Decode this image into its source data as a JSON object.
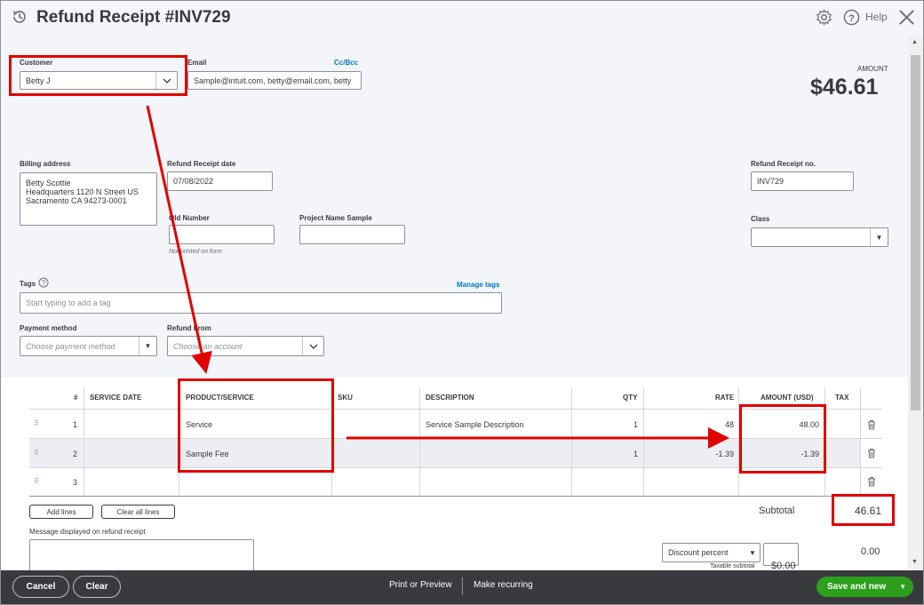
{
  "header": {
    "title": "Refund Receipt #INV729",
    "help_label": "Help",
    "icons": [
      "history-icon",
      "gear-icon",
      "help-icon",
      "close-icon"
    ]
  },
  "customer": {
    "label": "Customer",
    "value": "Betty J"
  },
  "email": {
    "label": "Email",
    "value": "Sample@intuit.com, betty@email.com, betty",
    "cc_bcc": "Cc/Bcc"
  },
  "amount": {
    "label": "AMOUNT",
    "value": "$46.61"
  },
  "billing": {
    "label": "Billing address",
    "value": "Betty Scottie\nHeadquarters 1120 N Street US\nSacramento CA 94273-0001"
  },
  "refund_date": {
    "label": "Refund Receipt date",
    "value": "07/08/2022"
  },
  "refund_no": {
    "label": "Refund Receipt no.",
    "value": "INV729"
  },
  "old_number": {
    "label": "Old Number",
    "hint": "Not printed on form"
  },
  "project_name": {
    "label": "Project Name Sample"
  },
  "class_field": {
    "label": "Class"
  },
  "tags": {
    "label": "Tags",
    "manage": "Manage tags",
    "placeholder": "Start typing to add a tag"
  },
  "payment_method": {
    "label": "Payment method",
    "placeholder": "Choose payment method"
  },
  "refund_from": {
    "label": "Refund From",
    "placeholder": "Choose an account"
  },
  "table": {
    "columns": [
      "#",
      "SERVICE DATE",
      "PRODUCT/SERVICE",
      "SKU",
      "DESCRIPTION",
      "QTY",
      "RATE",
      "AMOUNT (USD)",
      "TAX"
    ],
    "rows": [
      {
        "num": "1",
        "product": "Service",
        "description": "Service Sample Description",
        "qty": "1",
        "rate": "48",
        "amount": "48.00"
      },
      {
        "num": "2",
        "product": "Sample Fee",
        "description": "",
        "qty": "1",
        "rate": "-1.39",
        "amount": "-1.39"
      },
      {
        "num": "3",
        "product": "",
        "description": "",
        "qty": "",
        "rate": "",
        "amount": ""
      }
    ]
  },
  "actions": {
    "add_lines": "Add lines",
    "clear_all": "Clear all lines"
  },
  "subtotal": {
    "label": "Subtotal",
    "value": "46.61"
  },
  "message": {
    "label": "Message displayed on refund receipt"
  },
  "discount": {
    "select": "Discount percent",
    "value": "0.00"
  },
  "taxable": {
    "label": "Taxable subtotal",
    "value": "$0.00"
  },
  "footer": {
    "cancel": "Cancel",
    "clear": "Clear",
    "print_preview": "Print or Preview",
    "make_recurring": "Make recurring",
    "save_new": "Save and new"
  },
  "colors": {
    "accent_green": "#2ca01c",
    "link_blue": "#0077c5",
    "annotation_red": "#e00000",
    "footer_bg": "#393a3d"
  }
}
